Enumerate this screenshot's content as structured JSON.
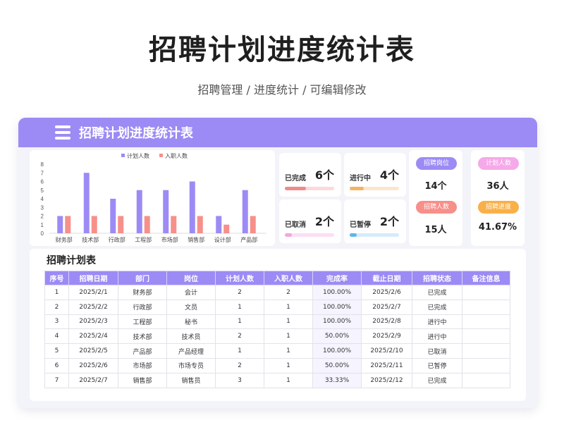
{
  "page": {
    "title": "招聘计划进度统计表",
    "subtitle": "招聘管理 /  进度统计  /  可编辑修改"
  },
  "card": {
    "title": "招聘计划进度统计表"
  },
  "chart_data": {
    "type": "bar",
    "categories": [
      "财务部",
      "技术部",
      "行政部",
      "工程部",
      "市场部",
      "销售部",
      "设计部",
      "产品部"
    ],
    "series": [
      {
        "name": "计划人数",
        "values": [
          2,
          7,
          4,
          5,
          5,
          6,
          2,
          5
        ],
        "color": "#9c8bf5"
      },
      {
        "name": "入职人数",
        "values": [
          2,
          2,
          2,
          2,
          2,
          2,
          1,
          2
        ],
        "color": "#f78f8a"
      }
    ],
    "yticks": [
      "0",
      "1",
      "2",
      "3",
      "4",
      "5",
      "6",
      "7",
      "8"
    ],
    "ylim": [
      0,
      8
    ],
    "legend": "top-center",
    "grid": false
  },
  "stats": [
    {
      "label": "已完成",
      "value": "6个",
      "fraction": 0.43,
      "track": "#fbd9dc",
      "fill": "#f2898b"
    },
    {
      "label": "进行中",
      "value": "4个",
      "fraction": 0.29,
      "track": "#fde6cf",
      "fill": "#f9b061"
    },
    {
      "label": "已取消",
      "value": "2个",
      "fraction": 0.14,
      "track": "#fbdff3",
      "fill": "#f4a6e0"
    },
    {
      "label": "已暂停",
      "value": "2个",
      "fraction": 0.14,
      "track": "#d6ecfb",
      "fill": "#5db6ee"
    }
  ],
  "kpis": [
    {
      "label": "招聘岗位",
      "value": "14个",
      "color": "#9c8bf5"
    },
    {
      "label": "招聘人数",
      "value": "15人",
      "color": "#f78f8a"
    },
    {
      "label": "计划人数",
      "value": "36人",
      "color": "#f5a9e8"
    },
    {
      "label": "招聘进度",
      "value": "41.67%",
      "color": "#f9b048"
    }
  ],
  "table": {
    "title": "招聘计划表",
    "headers": [
      "序号",
      "招聘日期",
      "部门",
      "岗位",
      "计划人数",
      "入职人数",
      "完成率",
      "截止日期",
      "招聘状态",
      "备注信息"
    ],
    "rows": [
      [
        "1",
        "2025/2/1",
        "财务部",
        "会计",
        "2",
        "2",
        "100.00%",
        "2025/2/6",
        "已完成",
        ""
      ],
      [
        "2",
        "2025/2/2",
        "行政部",
        "文员",
        "1",
        "1",
        "100.00%",
        "2025/2/7",
        "已完成",
        ""
      ],
      [
        "3",
        "2025/2/3",
        "工程部",
        "秘书",
        "1",
        "1",
        "100.00%",
        "2025/2/8",
        "进行中",
        ""
      ],
      [
        "4",
        "2025/2/4",
        "技术部",
        "技术员",
        "2",
        "1",
        "50.00%",
        "2025/2/9",
        "进行中",
        ""
      ],
      [
        "5",
        "2025/2/5",
        "产品部",
        "产品经理",
        "1",
        "1",
        "100.00%",
        "2025/2/10",
        "已取消",
        ""
      ],
      [
        "6",
        "2025/2/6",
        "市场部",
        "市场专员",
        "2",
        "1",
        "50.00%",
        "2025/2/11",
        "已暂停",
        ""
      ],
      [
        "7",
        "2025/2/7",
        "销售部",
        "销售员",
        "3",
        "1",
        "33.33%",
        "2025/2/12",
        "已完成",
        ""
      ]
    ]
  }
}
